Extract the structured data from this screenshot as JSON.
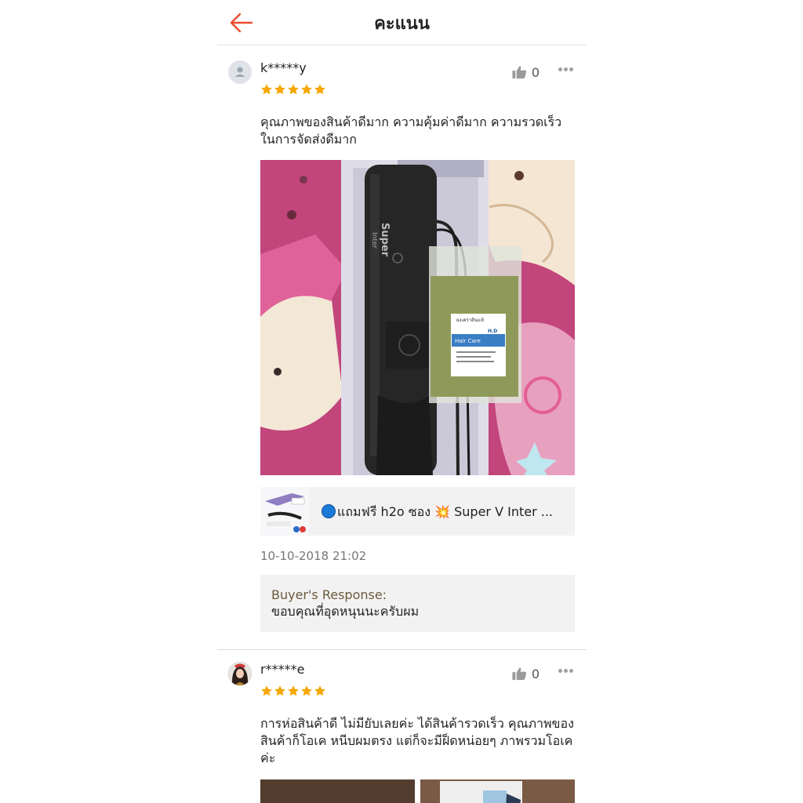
{
  "header": {
    "title": "คะแนน",
    "back_icon": "arrow-left-icon",
    "accent_color": "#ee4d2d"
  },
  "reviews": [
    {
      "username": "k*****y",
      "rating": 5,
      "likes": "0",
      "text": " คุณภาพของสินค้าดีมาก ความคุ้มค่าดีมาก ความรวดเร็วในการจัดส่งดีมาก",
      "product_name": "แถมฟรี h2o ซอง 💥 Super V Inter ...",
      "date": "10-10-2018 21:02",
      "response_label": "Buyer's Response:",
      "response_text": "ขอบคุณที่อุดหนุนนะครับผม"
    },
    {
      "username": "r*****e",
      "rating": 5,
      "likes": "0",
      "text": "การห่อสินค้าดี ไม่มียับเลยค่ะ ได้สินค้ารวดเร็ว คุณภาพของสินค้าก็โอเค หนีบผมตรง แต่ก็จะมีฝ็ดหน่อยๆ ภาพรวมโอเคค่ะ"
    }
  ],
  "photo_text": {
    "brand": "Super",
    "brand_sub": "Inter",
    "label_top": "ผงเคราตินแท้",
    "label_brand": "H.D",
    "label_band": "Hair Care"
  },
  "colors": {
    "star": "#f6a700",
    "response_label": "#6b5a3c",
    "card_bg": "#f2f2f2"
  }
}
